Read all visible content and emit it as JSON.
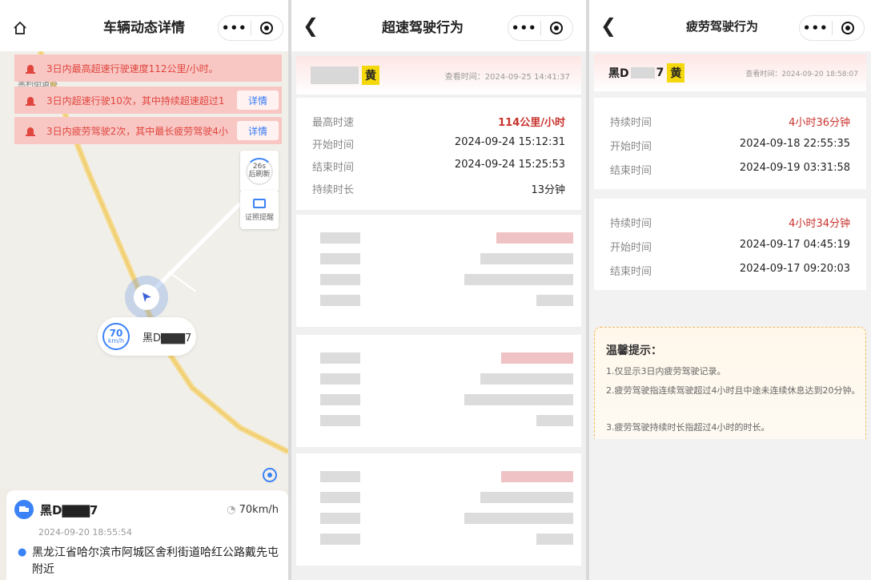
{
  "panel1": {
    "title": "车辆动态详情",
    "alerts": [
      {
        "text": "3日内最高超速行驶速度112公里/小时。",
        "detail": ""
      },
      {
        "text": "3日内超速行驶10次，其中持续超速超过1",
        "detail": "详情"
      },
      {
        "text": "3日内疲劳驾驶2次，其中最长疲劳驾驶4小",
        "detail": "详情"
      }
    ],
    "map_poi": "黑利街道办",
    "refresh": {
      "count": "26s",
      "label": "后刷新"
    },
    "license_reminder": "证照提醒",
    "car_marker": {
      "speed": "70",
      "unit": "km/h",
      "plate": "黑D▇▇▇7"
    },
    "vehicle": {
      "plate": "黑D▇▇▇7",
      "speed": "70km/h",
      "time": "2024-09-20 18:55:54",
      "address": "黑龙江省哈尔滨市阿城区舍利街道哈红公路戴先屯附近"
    }
  },
  "panel2": {
    "title": "超速驾驶行为",
    "plate_color": "黄",
    "view_time": "查看时间：2024-09-25 14:41:37",
    "rows": [
      {
        "k": "最高时速",
        "v": "114公里/小时",
        "red": true
      },
      {
        "k": "开始时间",
        "v": "2024-09-24 15:12:31",
        "red": false
      },
      {
        "k": "结束时间",
        "v": "2024-09-24 15:25:53",
        "red": false
      },
      {
        "k": "持续时长",
        "v": "13分钟",
        "red": false
      }
    ]
  },
  "panel3": {
    "title": "疲劳驾驶行为",
    "plate_prefix": "黑D",
    "plate_suffix": "7",
    "plate_color": "黄",
    "view_time": "查看时间：2024-09-20 18:58:07",
    "records": [
      [
        {
          "k": "持续时间",
          "v": "4小时36分钟",
          "red": true
        },
        {
          "k": "开始时间",
          "v": "2024-09-18 22:55:35",
          "red": false
        },
        {
          "k": "结束时间",
          "v": "2024-09-19 03:31:58",
          "red": false
        }
      ],
      [
        {
          "k": "持续时间",
          "v": "4小时34分钟",
          "red": true
        },
        {
          "k": "开始时间",
          "v": "2024-09-17 04:45:19",
          "red": false
        },
        {
          "k": "结束时间",
          "v": "2024-09-17 09:20:03",
          "red": false
        }
      ]
    ],
    "tip": {
      "title": "温馨提示：",
      "lines": [
        "1.仅显示3日内疲劳驾驶记录。",
        "2.疲劳驾驶指连续驾驶超过4小时且中途未连续休息达到20分钟。",
        "3.疲劳驾驶持续时长指超过4小时的时长。"
      ]
    }
  },
  "colors": {
    "alert_red": "#e0463e",
    "accent_blue": "#3b82f6",
    "plate_yellow": "#f4d80c",
    "value_red": "#c8322c"
  }
}
